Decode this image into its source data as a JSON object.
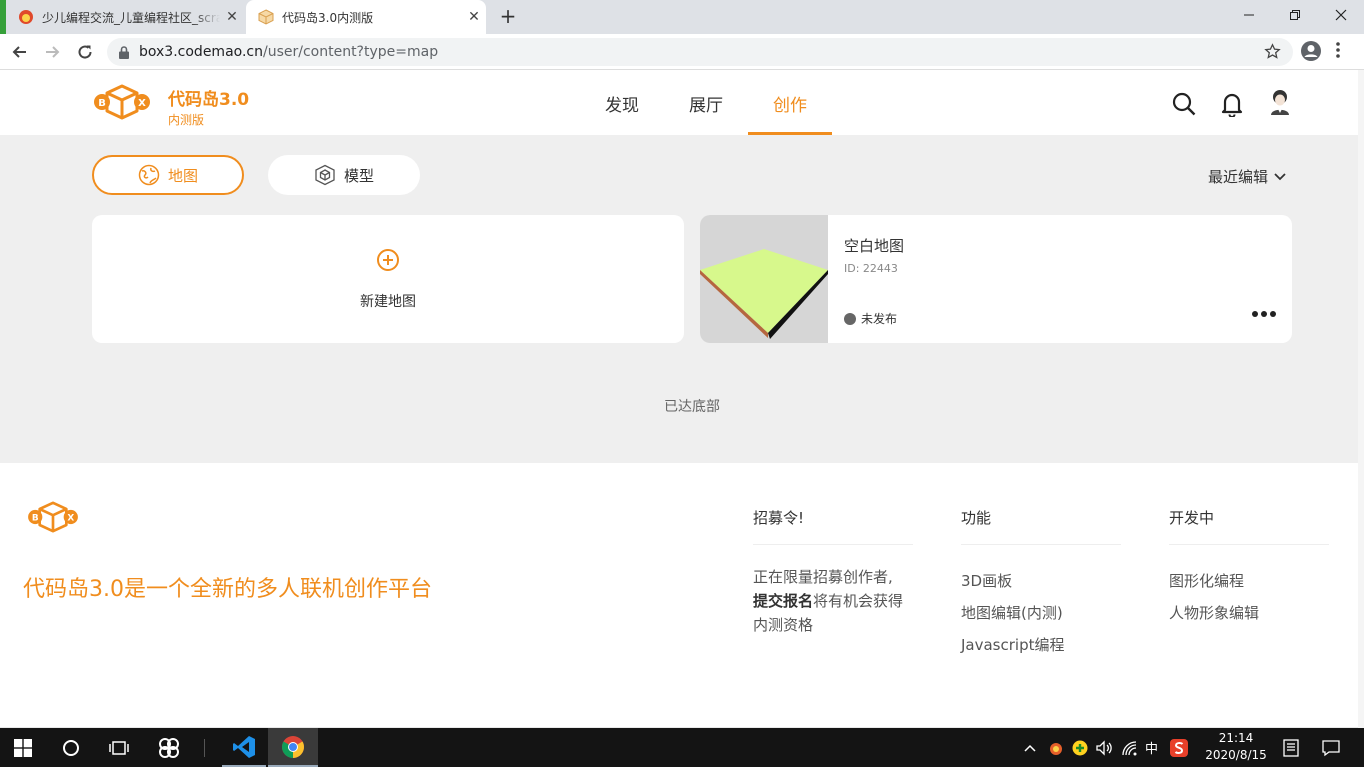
{
  "browser": {
    "tabs": [
      {
        "title": "少儿编程交流_儿童编程社区_scratch"
      },
      {
        "title": "代码岛3.0内测版"
      }
    ],
    "new_tab": "+",
    "url_host": "box3.codemao.cn",
    "url_path": "/user/content?type=map"
  },
  "header": {
    "brand_title": "代码岛3.0",
    "brand_sub": "内测版",
    "nav": [
      {
        "label": "发现"
      },
      {
        "label": "展厅"
      },
      {
        "label": "创作"
      }
    ],
    "active_nav": "创作"
  },
  "content": {
    "tabs": [
      {
        "label": "地图"
      },
      {
        "label": "模型"
      }
    ],
    "sort_label": "最近编辑",
    "new_card_label": "新建地图",
    "map": {
      "name": "空白地图",
      "id": "ID: 22443",
      "status": "未发布"
    },
    "end_text": "已达底部"
  },
  "footer": {
    "slogan": "代码岛3.0是一个全新的多人联机创作平台",
    "col1": {
      "heading": "招募令!",
      "desc_1": "正在限量招募创作者,",
      "desc_bold": "提交报名",
      "desc_2": "将有机会获得内测资格"
    },
    "col2": {
      "heading": "功能",
      "links": [
        "3D画板",
        "地图编辑(内测)",
        "Javascript编程"
      ]
    },
    "col3": {
      "heading": "开发中",
      "links": [
        "图形化编程",
        "人物形象编辑"
      ]
    }
  },
  "taskbar": {
    "ime": "中",
    "time": "21:14",
    "date": "2020/8/15"
  },
  "colors": {
    "accent": "#f08d1e",
    "content_bg": "#efefef",
    "map_top": "#d7f88c"
  }
}
